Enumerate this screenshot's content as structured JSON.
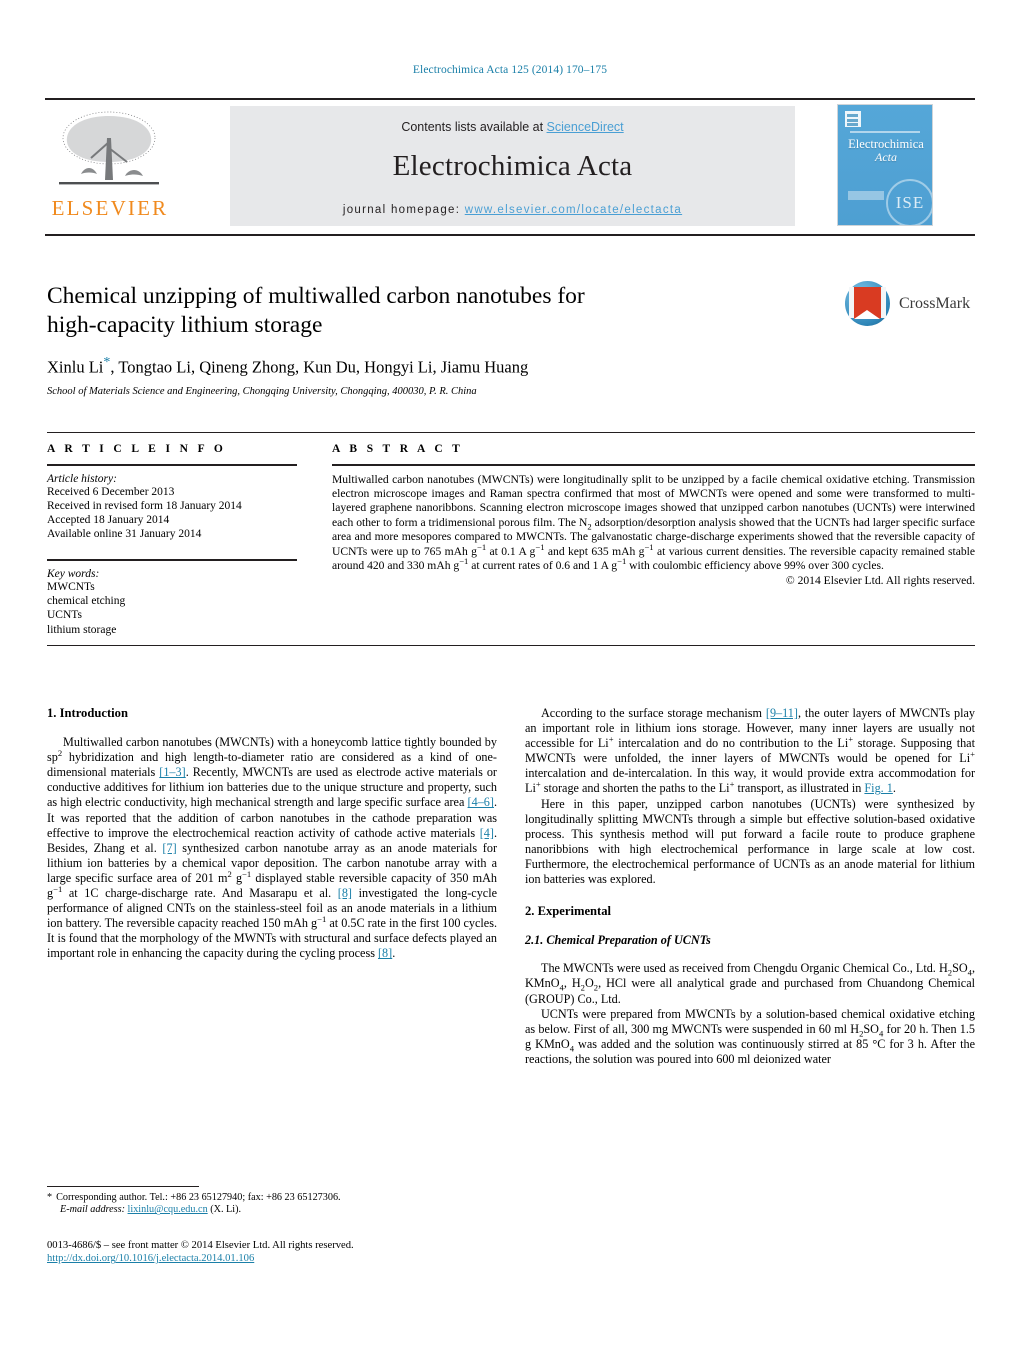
{
  "running_head": "Electrochimica Acta 125 (2014) 170–175",
  "masthead": {
    "contents_prefix": "Contents lists available at ",
    "sciencedirect": "ScienceDirect",
    "journal_name": "Electrochimica Acta",
    "homepage_label": "journal homepage: ",
    "homepage_url": "www.elsevier.com/locate/electacta",
    "publisher_wordmark": "ELSEVIER",
    "cover": {
      "title_line1": "Electrochimica",
      "title_line2": "Acta",
      "society_mark": "ISE"
    }
  },
  "article": {
    "title_line1": "Chemical unzipping of multiwalled carbon nanotubes for",
    "title_line2": "high-capacity lithium storage",
    "authors": "Xinlu Li",
    "authors_rest": ", Tongtao Li, Qineng Zhong, Kun Du, Hongyi Li, Jiamu Huang",
    "corresponding_marker": "*",
    "affiliation": "School of Materials Science and Engineering, Chongqing University, Chongqing, 400030, P. R. China",
    "crossmark_label": "CrossMark"
  },
  "article_info": {
    "heading": "A R T I C L E    I N F O",
    "history_label": "Article history:",
    "history": [
      "Received 6 December 2013",
      "Received in revised form 18 January 2014",
      "Accepted 18 January 2014",
      "Available online 31 January 2014"
    ],
    "keywords_label": "Key words:",
    "keywords": [
      "MWCNTs",
      "chemical etching",
      "UCNTs",
      "lithium storage"
    ]
  },
  "abstract": {
    "heading": "A B S T R A C T",
    "part1": "Multiwalled carbon nanotubes (MWCNTs) were longitudinally split to be unzipped by a facile chemical oxidative etching. Transmission electron microscope images and Raman spectra confirmed that most of MWCNTs were opened and some were transformed to multi-layered graphene nanoribbons. Scanning electron microscope images showed that unzipped carbon nanotubes (UCNTs) were interwined each other to form a tridimensional porous film. The N",
    "sub1": "2",
    "part2": " adsorption/desorption analysis showed that the UCNTs had larger specific surface area and more mesopores compared to MWCNTs. The galvanostatic charge-discharge experiments showed that the reversible capacity of UCNTs were up to 765 mAh g",
    "sup1": "−1",
    "part3": " at 0.1 A g",
    "sup2": "−1",
    "part4": " and kept 635 mAh g",
    "sup3": "−1",
    "part5": " at various current densities. The reversible capacity remained stable around 420 and 330 mAh g",
    "sup4": "−1",
    "part6": " at current rates of 0.6 and 1 A g",
    "sup5": "−1",
    "part7": " with coulombic efficiency above 99% over 300 cycles.",
    "copyright": "© 2014 Elsevier Ltd. All rights reserved."
  },
  "sections": {
    "introduction_heading": "1. Introduction",
    "intro_p1_a": "Multiwalled carbon nanotubes (MWCNTs) with a honeycomb lattice tightly bounded by sp",
    "intro_p1_sup": "2",
    "intro_p1_b": " hybridization and high length-to-diameter ratio are considered as a kind of one-dimensional materials ",
    "ref_1_3": "[1–3]",
    "intro_p1_c": ". Recently, MWCNTs are used as electrode active materials or conductive additives for lithium ion batteries due to the unique structure and property, such as high electric conductivity, high mechanical strength and large specific surface area ",
    "ref_4_6": "[4–6]",
    "intro_p1_d": ". It was reported that the addition of carbon nanotubes in the cathode preparation was effective to improve the electrochemical reaction activity of cathode active materials ",
    "ref_4": "[4]",
    "intro_p1_e": ". Besides, Zhang et al. ",
    "ref_7": "[7]",
    "intro_p1_f": " synthesized carbon nanotube array as an anode materials for lithium ion batteries by a chemical vapor deposition. The carbon nanotube array with a large specific surface area of 201 m",
    "intro_p1_sup2": "2",
    "intro_p1_g": " g",
    "intro_p1_sup3": "−1",
    "intro_p1_h": " displayed stable reversible capacity of 350 mAh g",
    "intro_p1_sup4": "−1",
    "intro_p1_i": " at 1C charge-discharge rate. And Masarapu et al. ",
    "ref_8": "[8]",
    "intro_p1_j": " investigated the long-cycle performance of aligned CNTs on the stainless-steel foil as an anode materials in a lithium ion battery. The reversible capacity reached 150 mAh g",
    "intro_p1_sup5": "−1",
    "intro_p1_k": " at 0.5C rate in the first 100 cycles. It is found that the morphology of the MWNTs with structural and surface defects played an important role in enhancing the capacity during the cycling process ",
    "ref_8b": "[8]",
    "intro_p1_l": ".",
    "right_p1_a": "According to the surface storage mechanism ",
    "ref_9_11": "[9–11]",
    "right_p1_b": ", the outer layers of MWCNTs play an important role in lithium ions storage. However, many inner layers are usually not accessible for Li",
    "sup_plus1": "+",
    "right_p1_c": " intercalation and do no contribution to the Li",
    "sup_plus2": "+",
    "right_p1_d": " storage. Supposing that MWCNTs were unfolded, the inner layers of MWCNTs would be opened for Li",
    "sup_plus3": "+",
    "right_p1_e": " intercalation and de-intercalation. In this way, it would provide extra accommodation for Li",
    "sup_plus4": "+",
    "right_p1_f": " storage and shorten the paths to the Li",
    "sup_plus5": "+",
    "right_p1_g": " transport, as illustrated in ",
    "fig1_link": "Fig. 1",
    "right_p1_h": ".",
    "right_p2": "Here in this paper, unzipped carbon nanotubes (UCNTs) were synthesized by longitudinally splitting MWCNTs through a simple but effective solution-based oxidative process. This synthesis method will put forward a facile route to produce graphene nanoribbions with high electrochemical performance in large scale at low cost. Furthermore, the electrochemical performance of UCNTs as an anode material for lithium ion batteries was explored.",
    "experimental_heading": "2. Experimental",
    "experimental_sub": "2.1. Chemical Preparation of UCNTs",
    "exp_p1_a": "The MWCNTs were used as received from Chengdu Organic Chemical Co., Ltd. H",
    "exp_sub1": "2",
    "exp_p1_b": "SO",
    "exp_sub2": "4",
    "exp_p1_c": ", KMnO",
    "exp_sub3": "4",
    "exp_p1_d": ", H",
    "exp_sub4": "2",
    "exp_p1_e": "O",
    "exp_sub5": "2",
    "exp_p1_f": ", HCl were all analytical grade and purchased from Chuandong Chemical (GROUP) Co., Ltd.",
    "exp_p2_a": "UCNTs were prepared from MWCNTs by a solution-based chemical oxidative etching as below. First of all, 300 mg MWCNTs were suspended in 60 ml H",
    "exp_sub6": "2",
    "exp_p2_b": "SO",
    "exp_sub7": "4",
    "exp_p2_c": " for 20 h. Then 1.5 g KMnO",
    "exp_sub8": "4",
    "exp_p2_d": " was added and the solution was continuously stirred at 85 °C for 3 h. After the reactions, the solution was poured into 600 ml deionized water"
  },
  "footer": {
    "corresponding_star": "*",
    "corresponding_text": "Corresponding author. Tel.: +86 23 65127940; fax: +86 23 65127306.",
    "email_label": "E-mail address:",
    "email": "lixinlu@cqu.edu.cn",
    "email_suffix": "(X. Li).",
    "issn_line": "0013-4686/$ – see front matter © 2014 Elsevier Ltd. All rights reserved.",
    "doi": "http://dx.doi.org/10.1016/j.electacta.2014.01.106"
  },
  "colors": {
    "link": "#1a7fa8",
    "elsevier_orange": "#f08a1e",
    "sciencedirect_blue": "#4a9fd4",
    "masthead_grey": "#e7e8ea",
    "cover_blue": "#55a7d8"
  }
}
